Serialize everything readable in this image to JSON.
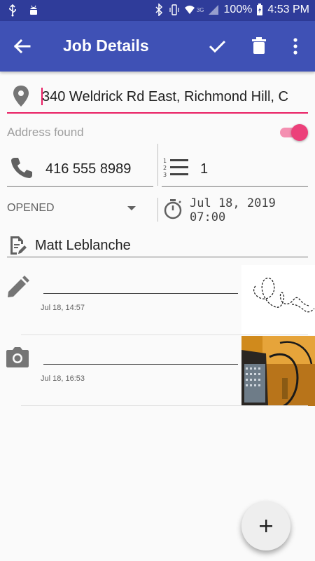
{
  "status_bar": {
    "battery": "100%",
    "time": "4:53 PM",
    "network": "3G"
  },
  "app_bar": {
    "title": "Job Details",
    "icons": [
      "arrow-back-icon",
      "check-icon",
      "delete-icon",
      "more-vert-icon"
    ]
  },
  "address": {
    "value": "340 Weldrick Rd East, Richmond Hill, C",
    "status_label": "Address found",
    "found_toggle_on": true
  },
  "phone": {
    "value": "416 555 8989"
  },
  "count": {
    "value": "1"
  },
  "job_status": {
    "value": "OPENED"
  },
  "schedule": {
    "date": "Jul 18, 2019",
    "time": "07:00"
  },
  "contact": {
    "name": "Matt Leblanche"
  },
  "attachments": [
    {
      "type": "signature",
      "icon": "pencil-icon",
      "timestamp": "Jul 18, 14:57"
    },
    {
      "type": "photo",
      "icon": "camera-icon",
      "timestamp": "Jul 18, 16:53"
    }
  ],
  "colors": {
    "status_bar": "#2f3c9a",
    "app_bar": "#3f51b5",
    "accent": "#e91e63",
    "toggle_thumb": "#ec407a"
  },
  "fab": {
    "icon": "plus-icon"
  }
}
